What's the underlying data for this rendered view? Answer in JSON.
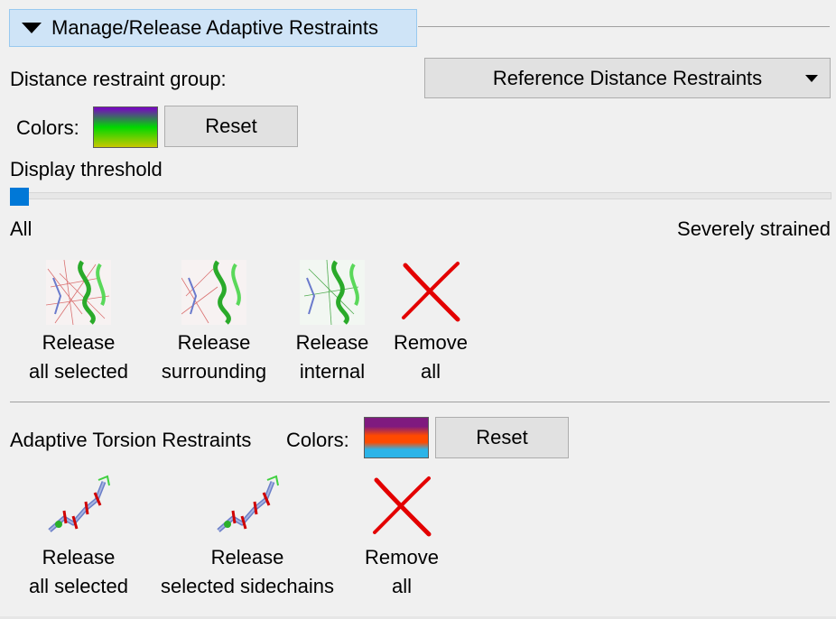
{
  "section": {
    "title": "Manage/Release Adaptive Restraints",
    "expanded": true
  },
  "distance": {
    "group_label": "Distance restraint group:",
    "group_value": "Reference Distance Restraints",
    "colors_label": "Colors:",
    "colors": [
      "#7b00c8",
      "#00d800",
      "#c8c800"
    ],
    "reset_label": "Reset",
    "threshold_label": "Display threshold",
    "threshold_value": 0.0,
    "min_label": "All",
    "max_label": "Severely strained",
    "tools": [
      {
        "line1": "Release",
        "line2": "all selected",
        "icon": "restraint-network-icon"
      },
      {
        "line1": "Release",
        "line2": "surrounding",
        "icon": "restraint-network-icon"
      },
      {
        "line1": "Release",
        "line2": "internal",
        "icon": "restraint-network-icon"
      },
      {
        "line1": "Remove",
        "line2": "all",
        "icon": "red-x-icon"
      }
    ]
  },
  "torsion": {
    "title": "Adaptive Torsion Restraints",
    "colors_label": "Colors:",
    "colors": [
      "#7f1a7f",
      "#ff4a00",
      "#2cb4e8"
    ],
    "reset_label": "Reset",
    "tools": [
      {
        "line1": "Release",
        "line2": "all selected",
        "icon": "peptide-torsion-icon"
      },
      {
        "line1": "Release",
        "line2": "selected sidechains",
        "icon": "peptide-torsion-icon"
      },
      {
        "line1": "Remove",
        "line2": "all",
        "icon": "red-x-icon"
      }
    ]
  }
}
